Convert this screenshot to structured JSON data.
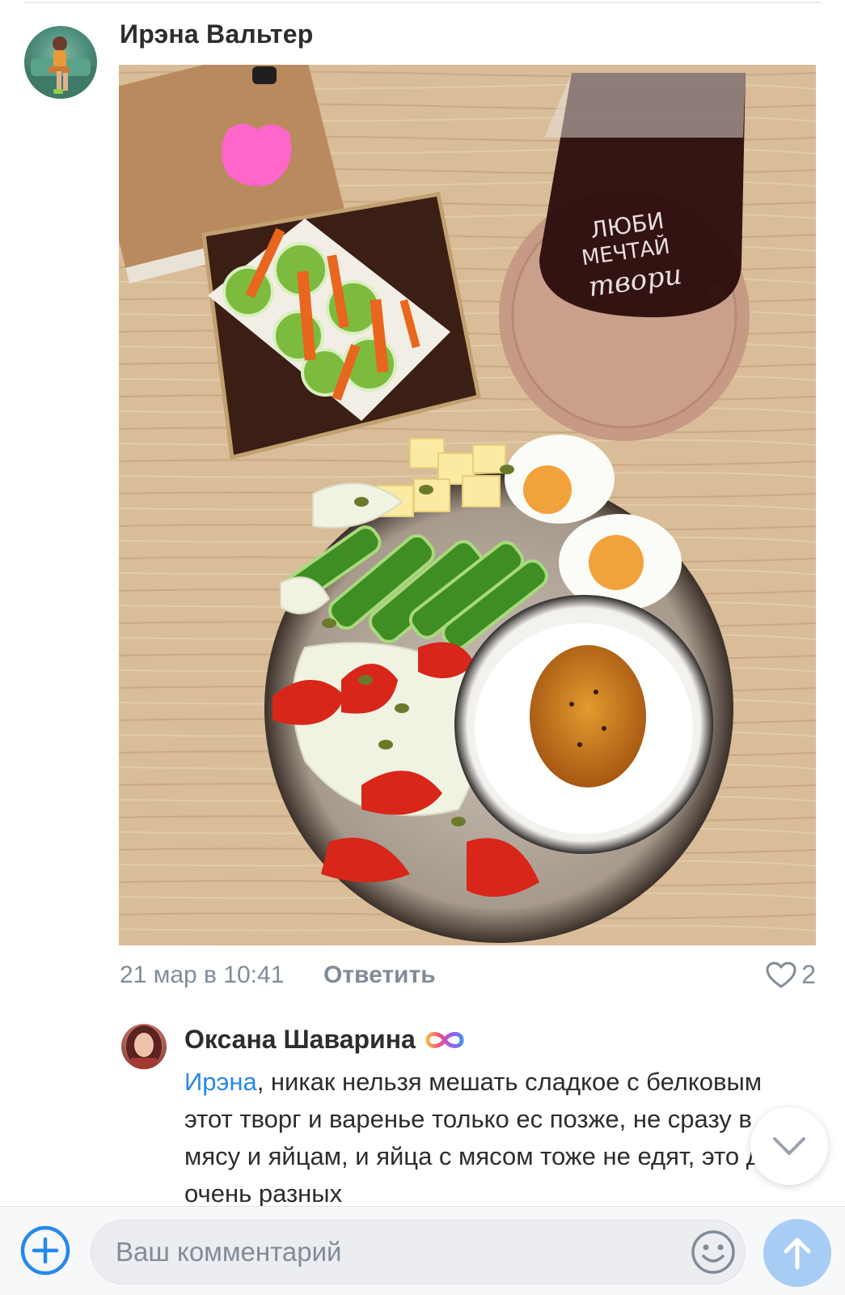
{
  "post": {
    "author": "Ирэна Вальтер",
    "date": "21 мар в 10:41",
    "reply_label": "Ответить",
    "likes": "2",
    "photo_text": {
      "line1": "ЛЮБИ",
      "line2": "МЕЧТАЙ",
      "line3": "твори"
    }
  },
  "reply": {
    "author": "Оксана Шаварина",
    "badge_icon": "infinity-badge-icon",
    "mention": "Ирэна",
    "text": ", никак нельзя мешать сладкое с белковым этот творг и варенье только ес позже, не сразу в мясу и яйцам, и яйца с мясом тоже не едят, это два очень разных"
  },
  "composer": {
    "placeholder": "Ваш комментарий"
  },
  "icons": {
    "add": "plus-circle-icon",
    "emoji": "smile-icon",
    "send": "arrow-up-icon",
    "scroll": "chevron-down-icon",
    "like": "heart-icon"
  },
  "colors": {
    "accent": "#2688eb",
    "send_disabled": "#a8cdf5",
    "text_primary": "#2c2d2e",
    "text_secondary": "#818c99"
  }
}
